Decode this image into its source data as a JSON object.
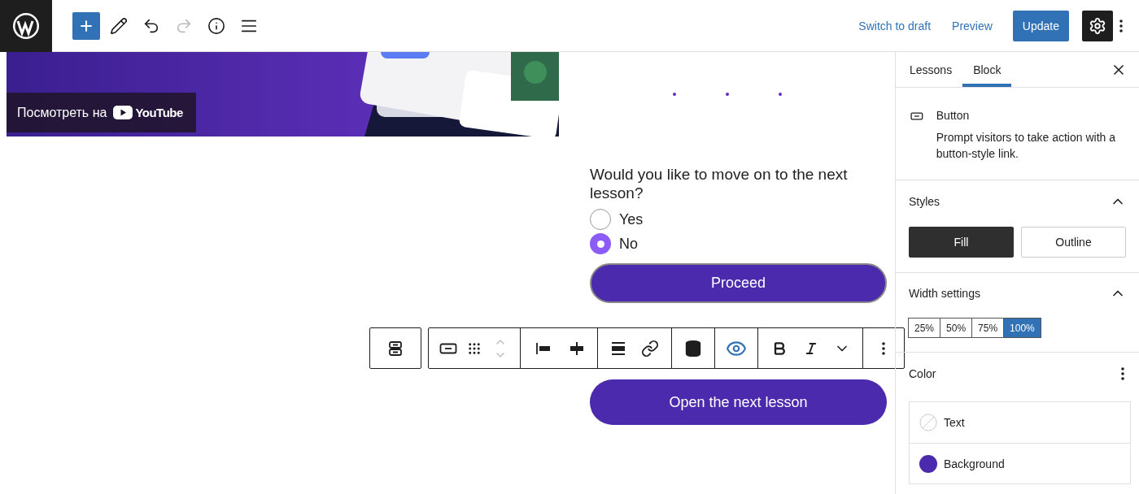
{
  "topbar": {
    "tools": [
      {
        "disabled": false
      },
      {
        "disabled": false
      },
      {
        "disabled": false
      },
      {
        "disabled": true
      },
      {
        "disabled": false
      },
      {
        "disabled": false
      }
    ],
    "links": [
      "Switch to draft",
      "Preview"
    ],
    "update": "Update",
    "settings": {
      "selected": true
    }
  },
  "video": {
    "kind": "picture",
    "overlay": "Посмотреть на",
    "brand": "YouTube"
  },
  "quiz": {
    "question": "Would you like to move on to the next lesson?",
    "options": [
      {
        "label": "Yes",
        "selected": false
      },
      {
        "label": "No",
        "selected": true
      }
    ],
    "button": "Proceed"
  },
  "block_toolbar": {
    "groups": [
      [
        {
          "disabled": false,
          "selected": false
        }
      ],
      [
        {
          "disabled": false,
          "selected": false
        },
        {
          "disabled": false,
          "selected": false
        },
        {
          "disabled": true,
          "selected": false
        }
      ],
      [
        {
          "disabled": false,
          "selected": false
        },
        {
          "disabled": false,
          "selected": false
        }
      ],
      [
        {
          "disabled": false,
          "selected": false
        },
        {
          "disabled": false,
          "selected": false
        }
      ],
      [
        {
          "disabled": false,
          "selected": false
        }
      ],
      [
        {
          "disabled": false,
          "selected": true
        }
      ],
      [
        {
          "disabled": false,
          "selected": false
        },
        {
          "disabled": false,
          "selected": false
        },
        {
          "disabled": false,
          "selected": false
        }
      ],
      [
        {
          "disabled": false,
          "selected": false
        }
      ]
    ]
  },
  "next_button": "Open the next lesson",
  "sidebar": {
    "tabs": [
      {
        "label": "Lessons",
        "selected": false
      },
      {
        "label": "Block",
        "selected": true
      }
    ],
    "block": {
      "name": "Button",
      "description": "Prompt visitors to take action with a button-style link."
    },
    "styles": {
      "title": "Styles",
      "expanded": true,
      "options": [
        {
          "label": "Fill",
          "selected": true
        },
        {
          "label": "Outline",
          "selected": false
        }
      ]
    },
    "width": {
      "title": "Width settings",
      "expanded": true,
      "options": [
        {
          "label": "25%",
          "selected": false
        },
        {
          "label": "50%",
          "selected": false
        },
        {
          "label": "75%",
          "selected": false
        },
        {
          "label": "100%",
          "selected": true
        }
      ]
    },
    "color": {
      "title": "Color",
      "items": [
        {
          "label": "Text"
        },
        {
          "label": "Background",
          "color": "#4c2aad"
        }
      ]
    }
  }
}
